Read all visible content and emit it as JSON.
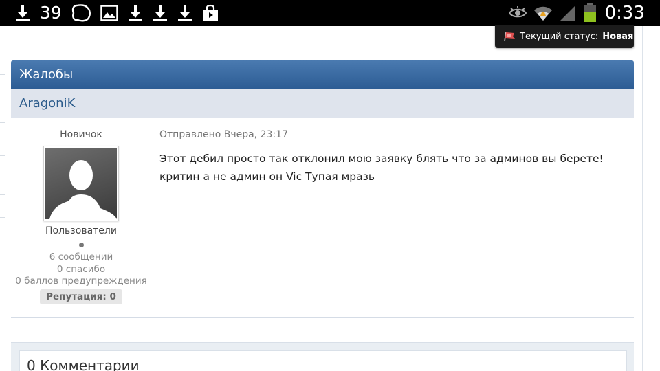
{
  "statusbar": {
    "notification_count": "39",
    "time": "0:33",
    "left_icons": [
      "download-icon",
      "notification-count",
      "speech-bubble-icon",
      "image-icon",
      "download-icon",
      "download-icon",
      "download-icon",
      "shopping-bag-icon"
    ],
    "right_icons": [
      "eye-icon",
      "wifi-icon",
      "cell-signal-icon",
      "battery-icon"
    ]
  },
  "status_tooltip": {
    "label": "Текущий статус:",
    "value": "Новая"
  },
  "panel": {
    "title": "Жалобы",
    "author": "AragoniK"
  },
  "user": {
    "rank": "Новичок",
    "group": "Пользователи",
    "posts": "6 сообщений",
    "thanks": "0 спасибо",
    "warnings": "0 баллов предупреждения",
    "reputation": "Репутация: 0"
  },
  "post": {
    "date": "Отправлено Вчера, 23:17",
    "body": "Этот дебил просто так отклонил мою заявку блять что за админов вы берете! критин а не админ он Vic Тупая мразь"
  },
  "comments": {
    "title": "0 Комментарии"
  },
  "colors": {
    "header_top": "#4a7ab0",
    "header_bottom": "#2c5c94",
    "author_bar": "#dfe4ed",
    "author_text": "#2c5c8c",
    "battery_green": "#8ec11f"
  }
}
